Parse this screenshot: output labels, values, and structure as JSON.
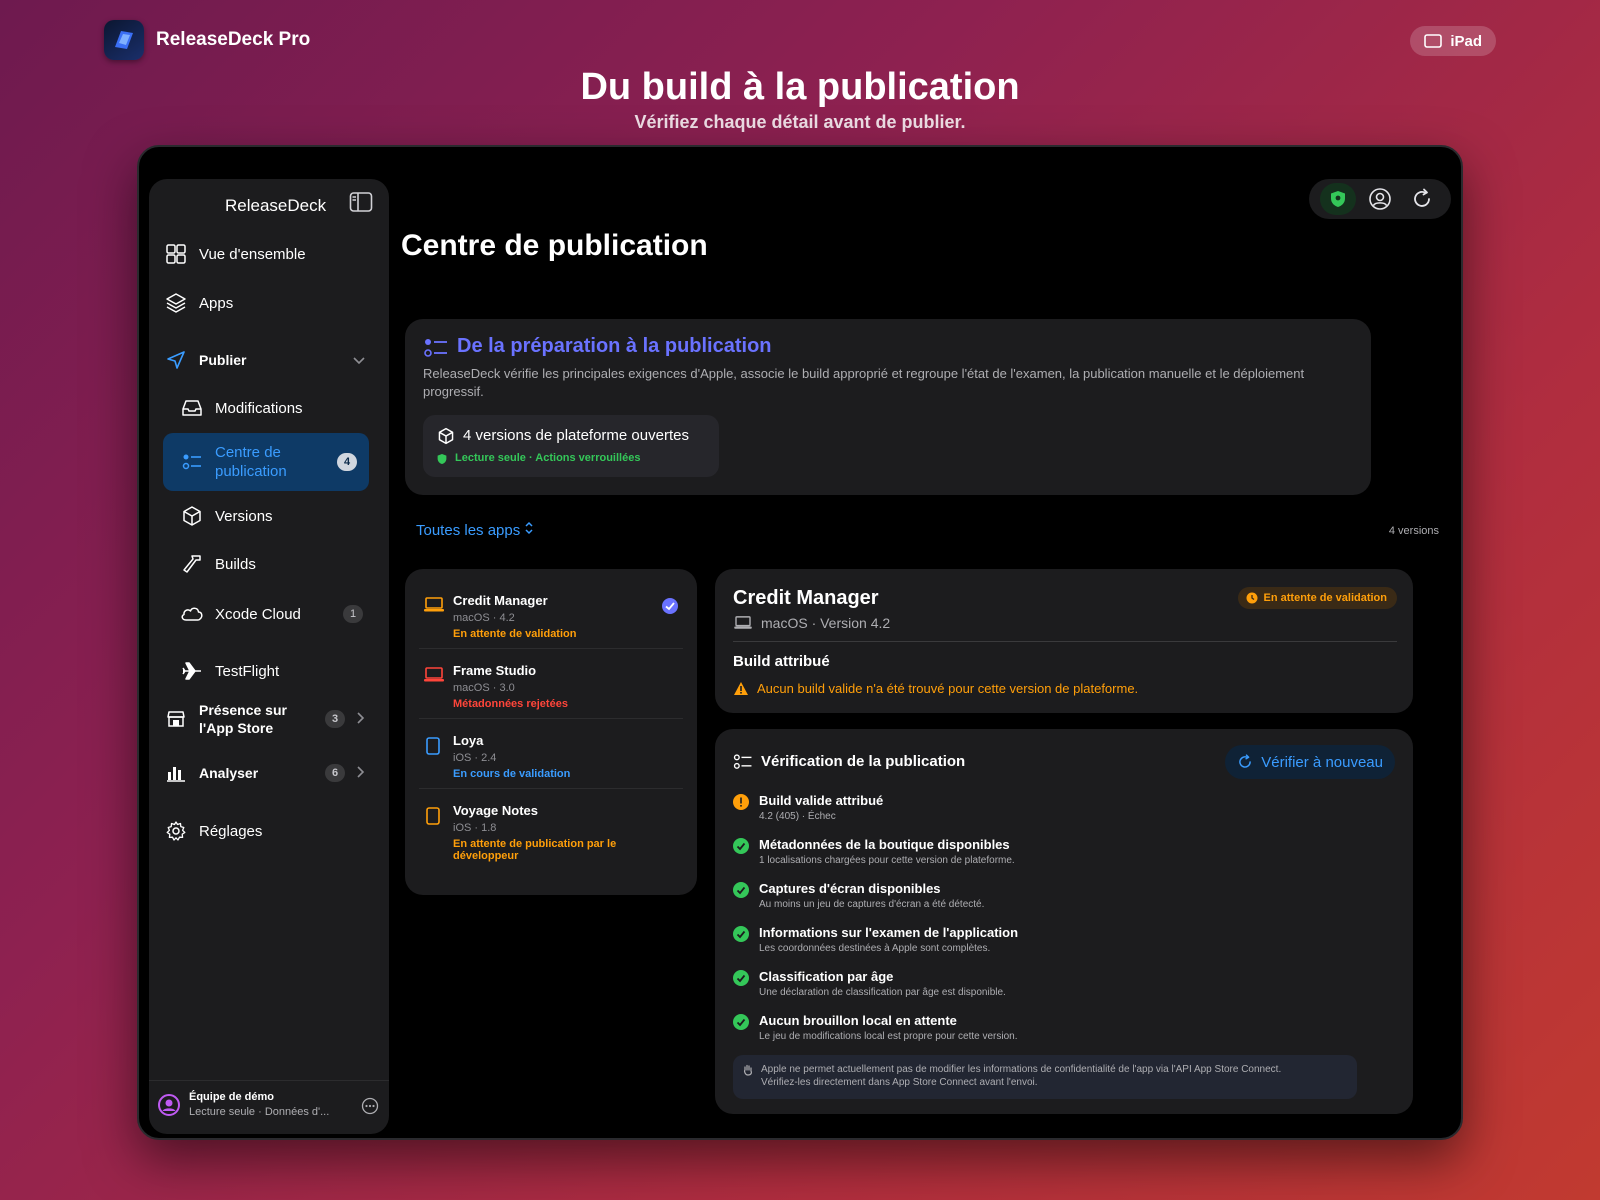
{
  "brand": {
    "name": "ReleaseDeck Pro"
  },
  "device_label": "iPad",
  "hero": {
    "title": "Du build à la publication",
    "subtitle": "Vérifiez chaque détail avant de publier."
  },
  "sidebar": {
    "title": "ReleaseDeck",
    "items": [
      {
        "label": "Vue d'ensemble",
        "icon": "grid-icon"
      },
      {
        "label": "Apps",
        "icon": "layers-icon"
      },
      {
        "label": "Publier",
        "icon": "paper-plane-icon"
      },
      {
        "label": "Modifications",
        "icon": "tray-icon"
      },
      {
        "label": "Centre de publication",
        "icon": "checklist-icon",
        "badge": "4"
      },
      {
        "label": "Versions",
        "icon": "cube-icon"
      },
      {
        "label": "Builds",
        "icon": "hammer-icon"
      },
      {
        "label": "Xcode Cloud",
        "icon": "cloud-icon",
        "badge": "1"
      },
      {
        "label": "TestFlight",
        "icon": "airplane-icon"
      },
      {
        "label": "Présence sur l'App Store",
        "icon": "storefront-icon",
        "badge": "3"
      },
      {
        "label": "Analyser",
        "icon": "chart-icon",
        "badge": "6"
      },
      {
        "label": "Réglages",
        "icon": "gear-icon"
      }
    ],
    "footer": {
      "team": "Équipe de démo",
      "subtitle": "Lecture seule · Données d'..."
    }
  },
  "page": {
    "title": "Centre de publication"
  },
  "intro": {
    "title": "De la préparation à la publication",
    "text": "ReleaseDeck vérifie les principales exigences d'Apple, associe le build approprié et regroupe l'état de l'examen, la publication manuelle et le déploiement progressif.",
    "chip_title": "4 versions de plateforme ouvertes",
    "chip_subtitle": "Lecture seule · Actions verrouillées"
  },
  "filter": {
    "label": "Toutes les apps",
    "count": "4 versions"
  },
  "apps": [
    {
      "name": "Credit Manager",
      "meta": "macOS · 4.2",
      "status": "En attente de validation",
      "status_color": "#ff9f0a",
      "icon_color": "#ff9f0a"
    },
    {
      "name": "Frame Studio",
      "meta": "macOS · 3.0",
      "status": "Métadonnées rejetées",
      "status_color": "#ff453a",
      "icon_color": "#ff453a"
    },
    {
      "name": "Loya",
      "meta": "iOS · 2.4",
      "status": "En cours de validation",
      "status_color": "#3a9cff",
      "icon_color": "#3a9cff"
    },
    {
      "name": "Voyage Notes",
      "meta": "iOS · 1.8",
      "status": "En attente de publication par le développeur",
      "status_color": "#ff9f0a",
      "icon_color": "#ff9f0a"
    }
  ],
  "detail": {
    "title": "Credit Manager",
    "subtitle": "macOS · Version 4.2",
    "status": "En attente de validation",
    "build_label": "Build attribué",
    "build_warning": "Aucun build valide n'a été trouvé pour cette version de plateforme."
  },
  "verify": {
    "title": "Vérification de la publication",
    "button": "Vérifier à nouveau",
    "items": [
      {
        "title": "Build valide attribué",
        "desc": "4.2 (405) · Échec",
        "state": "warning"
      },
      {
        "title": "Métadonnées de la boutique disponibles",
        "desc": "1 localisations chargées pour cette version de plateforme.",
        "state": "ok"
      },
      {
        "title": "Captures d'écran disponibles",
        "desc": "Au moins un jeu de captures d'écran a été détecté.",
        "state": "ok"
      },
      {
        "title": "Informations sur l'examen de l'application",
        "desc": "Les coordonnées destinées à Apple sont complètes.",
        "state": "ok"
      },
      {
        "title": "Classification par âge",
        "desc": "Une déclaration de classification par âge est disponible.",
        "state": "ok"
      },
      {
        "title": "Aucun brouillon local en attente",
        "desc": "Le jeu de modifications local est propre pour cette version.",
        "state": "ok"
      }
    ],
    "note_line1": "Apple ne permet actuellement pas de modifier les informations de confidentialité de l'app via l'API App Store Connect.",
    "note_line2": "Vérifiez-les directement dans App Store Connect avant l'envoi."
  },
  "colors": {
    "accent": "#3a9cff",
    "success": "#34c759",
    "warning": "#ff9f0a",
    "error": "#ff453a",
    "indigo": "#6a72ff"
  }
}
